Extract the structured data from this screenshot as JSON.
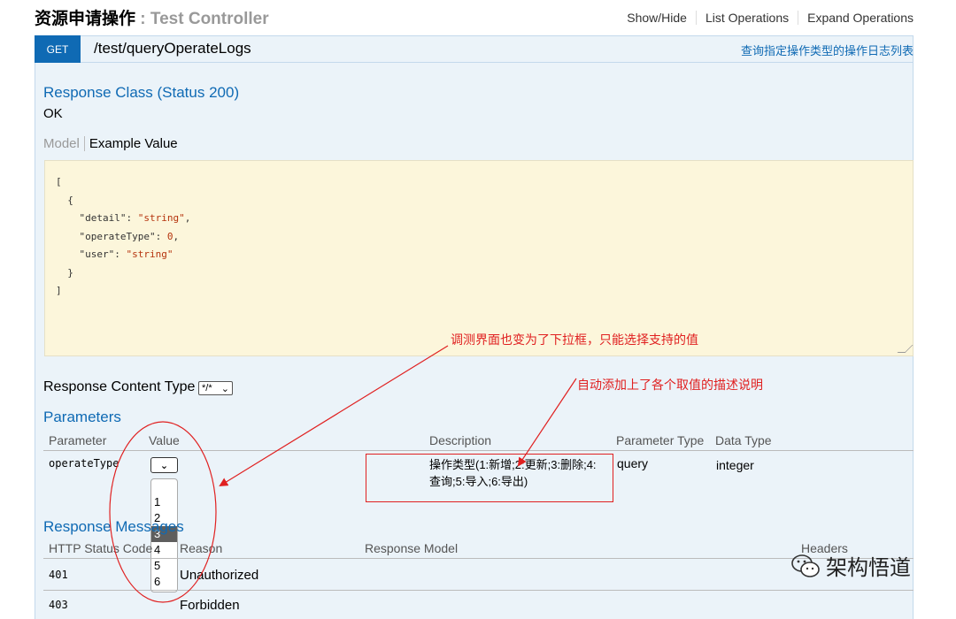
{
  "header": {
    "title_cn": "资源申请操作",
    "title_sep": " : ",
    "title_en": "Test Controller",
    "links": [
      "Show/Hide",
      "List Operations",
      "Expand Operations"
    ]
  },
  "operation": {
    "method": "GET",
    "path": "/test/queryOperateLogs",
    "summary": "查询指定操作类型的操作日志列表"
  },
  "response_class": {
    "title": "Response Class (Status 200)",
    "status_text": "OK",
    "tabs": {
      "model": "Model",
      "example": "Example Value"
    },
    "example_lines": {
      "l1": "[",
      "l2": "  {",
      "detail_key": "    \"detail\": ",
      "detail_val": "\"string\"",
      "optype_key": "    \"operateType\": ",
      "optype_val": "0",
      "user_key": "    \"user\": ",
      "user_val": "\"string\"",
      "l6": "  }",
      "l7": "]"
    }
  },
  "response_content_type": {
    "label": "Response Content Type",
    "value": "*/*"
  },
  "parameters": {
    "title": "Parameters",
    "headers": [
      "Parameter",
      "Value",
      "Description",
      "Parameter Type",
      "Data Type"
    ],
    "row": {
      "name": "operateType",
      "description": "操作类型(1:新增;2:更新;3:删除;4:查询;5:导入;6:导出)",
      "param_type": "query",
      "data_type": "integer"
    },
    "options": [
      "1",
      "2",
      "3",
      "4",
      "5",
      "6"
    ],
    "selected_option": "3"
  },
  "response_messages": {
    "title": "Response Messages",
    "headers": [
      "HTTP Status Code",
      "Reason",
      "Response Model",
      "Headers"
    ],
    "rows": [
      {
        "code": "401",
        "reason": "Unauthorized"
      },
      {
        "code": "403",
        "reason": "Forbidden"
      }
    ]
  },
  "annotations": {
    "top": "调测界面也变为了下拉框，只能选择支持的值",
    "right": "自动添加上了各个取值的描述说明"
  },
  "watermark": "架构悟道",
  "colors": {
    "accent": "#0f6ab4",
    "panel_bg": "#ebf3f9",
    "code_bg": "#fcf6db",
    "annotation_red": "#e02020"
  }
}
